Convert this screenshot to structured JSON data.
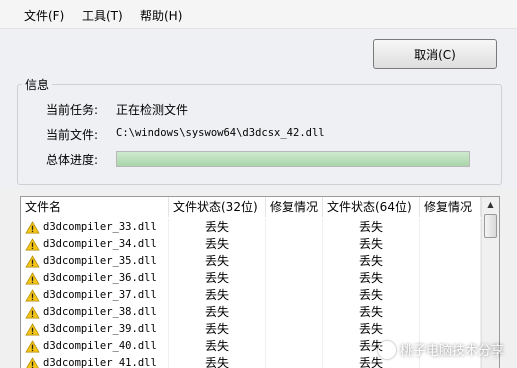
{
  "menu": [
    {
      "label": "文件(F)"
    },
    {
      "label": "工具(T)"
    },
    {
      "label": "帮助(H)"
    }
  ],
  "cancel_label": "取消(C)",
  "info": {
    "group_title": "信息",
    "task_label": "当前任务:",
    "task_value": "正在检测文件",
    "file_label": "当前文件:",
    "file_value": "C:\\windows\\syswow64\\d3dcsx_42.dll",
    "progress_label": "总体进度:",
    "progress_fraction": 1.0
  },
  "table": {
    "columns": [
      "文件名",
      "文件状态(32位)",
      "修复情况",
      "文件状态(64位)",
      "修复情况"
    ],
    "rows": [
      {
        "name": "d3dcompiler_33.dll",
        "status32": "丢失",
        "fix32": "",
        "status64": "丢失",
        "fix64": ""
      },
      {
        "name": "d3dcompiler_34.dll",
        "status32": "丢失",
        "fix32": "",
        "status64": "丢失",
        "fix64": ""
      },
      {
        "name": "d3dcompiler_35.dll",
        "status32": "丢失",
        "fix32": "",
        "status64": "丢失",
        "fix64": ""
      },
      {
        "name": "d3dcompiler_36.dll",
        "status32": "丢失",
        "fix32": "",
        "status64": "丢失",
        "fix64": ""
      },
      {
        "name": "d3dcompiler_37.dll",
        "status32": "丢失",
        "fix32": "",
        "status64": "丢失",
        "fix64": ""
      },
      {
        "name": "d3dcompiler_38.dll",
        "status32": "丢失",
        "fix32": "",
        "status64": "丢失",
        "fix64": ""
      },
      {
        "name": "d3dcompiler_39.dll",
        "status32": "丢失",
        "fix32": "",
        "status64": "丢失",
        "fix64": ""
      },
      {
        "name": "d3dcompiler_40.dll",
        "status32": "丢失",
        "fix32": "",
        "status64": "丢失",
        "fix64": ""
      },
      {
        "name": "d3dcompiler_41.dll",
        "status32": "丢失",
        "fix32": "",
        "status64": "丢失",
        "fix64": ""
      }
    ],
    "row_icon": "warning-icon"
  },
  "watermark": "桃子电脑技术分享",
  "colors": {
    "warning": "#f5c518",
    "progress": "#a9d6a9"
  }
}
